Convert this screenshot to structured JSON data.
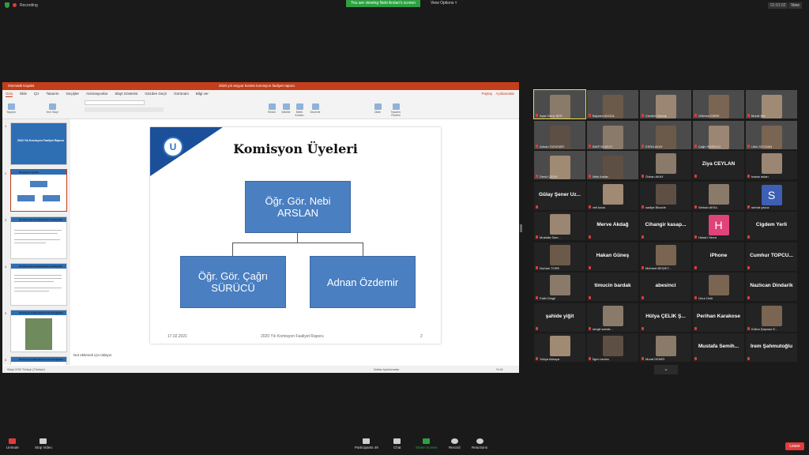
{
  "topbar": {
    "recording": "Recording",
    "viewing_banner": "You are viewing Nebi Arslan's screen",
    "view_options": "View Options ˅",
    "timer": "01:01:02",
    "view": "View"
  },
  "ppt": {
    "autosave": "Otomatik Kaydet",
    "doc_title": "2020 yılı seyyar komite komisyon faaliyet raporu",
    "tabs": [
      "Giriş",
      "Ekle",
      "Çiz",
      "Tasarım",
      "Geçişler",
      "Animasyonlar",
      "Slayt Gösterisi",
      "Gözden Geçir",
      "Görünüm",
      "Bilgi ver"
    ],
    "share": "Paylaş",
    "comments": "Açıklamalar",
    "ribbon": {
      "paste": "Yapıştır",
      "new_slide": "Yeni Slayt",
      "shapes": "Resim",
      "arrange": "Şekiller",
      "textbox": "Metin Kutusu",
      "arrange2": "Düzenle",
      "dictate": "Dikte",
      "designer": "Tasarım Fikirleri"
    },
    "thumb_titles": [
      "2020 Yılı Komisyon Faaliyet Raporu",
      "Komisyon Üyeleri",
      "Komisyonda Gerekleştirilen Faaliyetler",
      "Komisyonda Gerekleştirilen Faaliyetler",
      "Komisyon Faaliyetlerine Ait Fotoğraflar",
      "Komisyon Faaliyetlerine Ait Fotoğraflar"
    ],
    "thumb_numbers": [
      "1",
      "2",
      "3",
      "4",
      "5",
      "6"
    ],
    "slide": {
      "title": "Komisyon Üyeleri",
      "top_box": "Öğr. Gör. Nebi ARSLAN",
      "left_box": "Öğr. Gör. Çağrı SÜRÜCÜ",
      "right_box": "Adnan Özdemir",
      "footer_date": "17.02.2021",
      "footer_title": "2020 Yılı Komisyon Faaliyet Raporu",
      "footer_page": "2"
    },
    "notes": "Not eklemek için tıklayın",
    "status": "Slayt 2/30    Türkçe (Türkiye)",
    "status_right": "Notlar   Açıklamalar",
    "zoom": "% 61"
  },
  "participants": [
    {
      "name": "Ayşe Genç ŞER",
      "type": "video"
    },
    {
      "name": "Bayram AKGÜL",
      "type": "video"
    },
    {
      "name": "Cevdet Gümüş",
      "type": "video"
    },
    {
      "name": "Gökhan EMRE",
      "type": "video"
    },
    {
      "name": "Murat Şen",
      "type": "video"
    },
    {
      "name": "Adnan ÖZDEMİR",
      "type": "video"
    },
    {
      "name": "BARTIN MYO",
      "type": "video"
    },
    {
      "name": "ESRA AKAY",
      "type": "video"
    },
    {
      "name": "Çağrı SÜRÜCÜ",
      "type": "video"
    },
    {
      "name": "Ufuk SOYDAN",
      "type": "video"
    },
    {
      "name": "Deniz ÇELİK",
      "type": "video"
    },
    {
      "name": "Nebi Arslan",
      "type": "video"
    },
    {
      "name": "Özkan AKAY",
      "type": "photo"
    },
    {
      "name": "Ziya CEYLAN",
      "type": "text"
    },
    {
      "name": "hasan aslan",
      "type": "photo"
    },
    {
      "name": "Gülay Şener Uz...",
      "type": "text"
    },
    {
      "name": "veli kocal",
      "type": "photo"
    },
    {
      "name": "sadiye Bilozde",
      "type": "photo"
    },
    {
      "name": "Serkan AKSU",
      "type": "photo"
    },
    {
      "name": "serhat yavuz",
      "type": "avatar",
      "letter": "S",
      "color": "#3d5fb5"
    },
    {
      "name": "Mustafa Savr...",
      "type": "photo"
    },
    {
      "name": "Merve Akdağ",
      "type": "text"
    },
    {
      "name": "Cihangir kasap...",
      "type": "text"
    },
    {
      "name": "Hasan Yavuz",
      "type": "avatar",
      "letter": "H",
      "color": "#e0427a"
    },
    {
      "name": "Cigdem Yerli",
      "type": "text"
    },
    {
      "name": "Nurhan TORE",
      "type": "photo"
    },
    {
      "name": "Hakan Güneş",
      "type": "text"
    },
    {
      "name": "Mehmet BEŞİKT...",
      "type": "photo"
    },
    {
      "name": "iPhone",
      "type": "text"
    },
    {
      "name": "Cumhur TOPCU...",
      "type": "text"
    },
    {
      "name": "Fatih Dingil",
      "type": "photo"
    },
    {
      "name": "timucin bardak",
      "type": "text"
    },
    {
      "name": "abesinci",
      "type": "text"
    },
    {
      "name": "Onur Ünlü",
      "type": "photo"
    },
    {
      "name": "Nazlıcan Dindarik",
      "type": "text"
    },
    {
      "name": "şahide yiğit",
      "type": "text"
    },
    {
      "name": "sevgil sarrak...",
      "type": "photo"
    },
    {
      "name": "Hülya ÇELİK Ş...",
      "type": "text"
    },
    {
      "name": "Perihan Karakose",
      "type": "text"
    },
    {
      "name": "Kübra Şaşmaz E...",
      "type": "photo"
    },
    {
      "name": "Yahya Akkaya",
      "type": "photo"
    },
    {
      "name": "İlgen sevinc",
      "type": "photo"
    },
    {
      "name": "Murat DEMİR",
      "type": "photo"
    },
    {
      "name": "Mustafa Semih...",
      "type": "text"
    },
    {
      "name": "İrem Şahmutoğlu",
      "type": "text"
    }
  ],
  "bottombar": {
    "unmute": "Unmute",
    "stop_video": "Stop Video",
    "participants": "Participants",
    "participants_count": "49",
    "chat": "Chat",
    "share_screen": "Share Screen",
    "record": "Record",
    "reactions": "Reactions",
    "leave": "Leave"
  }
}
